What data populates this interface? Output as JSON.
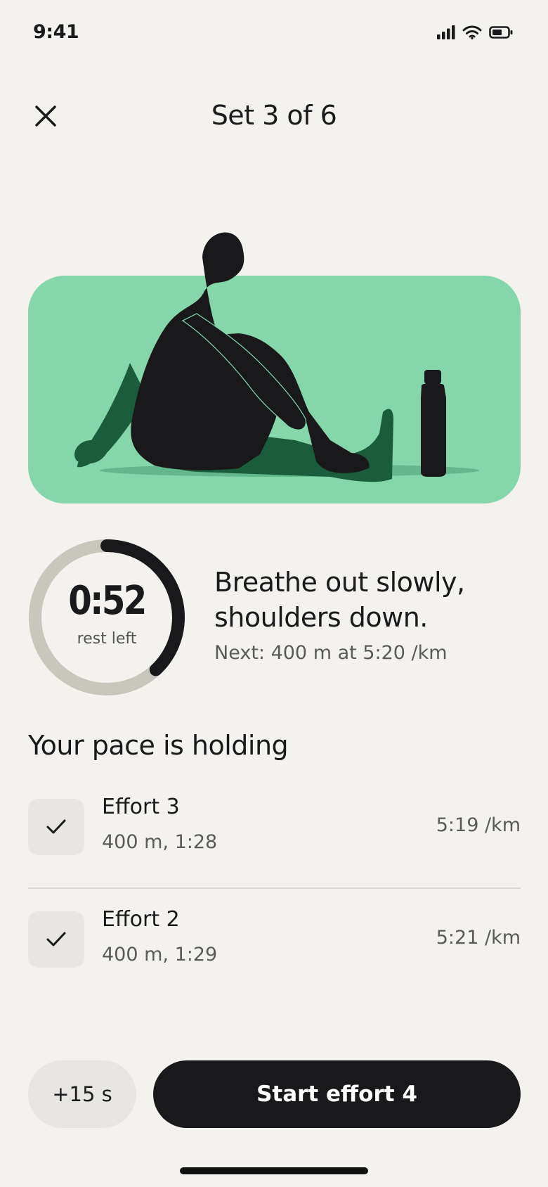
{
  "status_bar": {
    "time": "9:41",
    "icons": [
      "signal-icon",
      "wifi-icon",
      "battery-icon"
    ]
  },
  "header": {
    "close_icon": "close-icon",
    "title": "Set 3 of 6"
  },
  "illustration": {
    "background_color": "#86d6ab",
    "accent_color": "#1b5c3d"
  },
  "timer": {
    "value": "0:52",
    "caption": "rest left",
    "progress": 0.38,
    "track_color": "#c9c6bd",
    "progress_color": "#19191b"
  },
  "cue": {
    "text": "Breathe out slowly, shoulders down.",
    "next": "Next: 400 m at 5:20 /km"
  },
  "pace_section": {
    "title": "Your pace is holding",
    "efforts": [
      {
        "title": "Effort 3",
        "detail": "400 m, 1:28",
        "pace": "5:19 /km",
        "icon": "check-icon"
      },
      {
        "title": "Effort 2",
        "detail": "400 m, 1:29",
        "pace": "5:21 /km",
        "icon": "check-icon"
      }
    ]
  },
  "actions": {
    "add_time_label": "+15 s",
    "start_label": "Start effort 4"
  }
}
